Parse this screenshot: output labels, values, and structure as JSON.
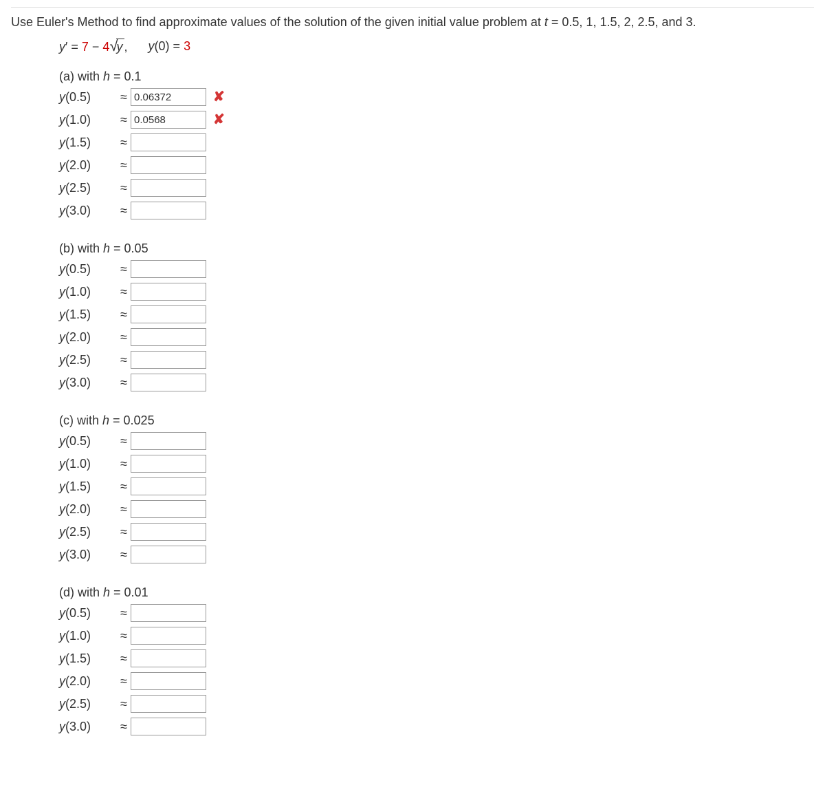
{
  "instruction": {
    "text_before_t": "Use Euler's Method to find approximate values of the solution of the given initial value problem at  ",
    "t_var": "t",
    "text_after_t": " = 0.5, 1, 1.5, 2, 2.5, and 3."
  },
  "equation": {
    "lhs_y": "y",
    "lhs_prime": "′ = ",
    "coef1": "7",
    "minus": " − ",
    "coef2": "4",
    "sqrt_arg": "y",
    "comma": ",",
    "ic_y": "y",
    "ic_rest": "(0) = ",
    "ic_val": "3"
  },
  "approx_symbol": "≈",
  "parts": [
    {
      "key": "a",
      "header_prefix": "(a) with  ",
      "h_var": "h",
      "header_suffix": " = 0.1",
      "rows": [
        {
          "label_y": "y",
          "label_rest": "(0.5)",
          "value": "0.06372",
          "mark": "wrong"
        },
        {
          "label_y": "y",
          "label_rest": "(1.0)",
          "value": "0.0568",
          "mark": "wrong"
        },
        {
          "label_y": "y",
          "label_rest": "(1.5)",
          "value": "",
          "mark": ""
        },
        {
          "label_y": "y",
          "label_rest": "(2.0)",
          "value": "",
          "mark": ""
        },
        {
          "label_y": "y",
          "label_rest": "(2.5)",
          "value": "",
          "mark": ""
        },
        {
          "label_y": "y",
          "label_rest": "(3.0)",
          "value": "",
          "mark": ""
        }
      ]
    },
    {
      "key": "b",
      "header_prefix": "(b) with  ",
      "h_var": "h",
      "header_suffix": " = 0.05",
      "rows": [
        {
          "label_y": "y",
          "label_rest": "(0.5)",
          "value": "",
          "mark": ""
        },
        {
          "label_y": "y",
          "label_rest": "(1.0)",
          "value": "",
          "mark": ""
        },
        {
          "label_y": "y",
          "label_rest": "(1.5)",
          "value": "",
          "mark": ""
        },
        {
          "label_y": "y",
          "label_rest": "(2.0)",
          "value": "",
          "mark": ""
        },
        {
          "label_y": "y",
          "label_rest": "(2.5)",
          "value": "",
          "mark": ""
        },
        {
          "label_y": "y",
          "label_rest": "(3.0)",
          "value": "",
          "mark": ""
        }
      ]
    },
    {
      "key": "c",
      "header_prefix": "(c) with  ",
      "h_var": "h",
      "header_suffix": " = 0.025",
      "rows": [
        {
          "label_y": "y",
          "label_rest": "(0.5)",
          "value": "",
          "mark": ""
        },
        {
          "label_y": "y",
          "label_rest": "(1.0)",
          "value": "",
          "mark": ""
        },
        {
          "label_y": "y",
          "label_rest": "(1.5)",
          "value": "",
          "mark": ""
        },
        {
          "label_y": "y",
          "label_rest": "(2.0)",
          "value": "",
          "mark": ""
        },
        {
          "label_y": "y",
          "label_rest": "(2.5)",
          "value": "",
          "mark": ""
        },
        {
          "label_y": "y",
          "label_rest": "(3.0)",
          "value": "",
          "mark": ""
        }
      ]
    },
    {
      "key": "d",
      "header_prefix": "(d) with  ",
      "h_var": "h",
      "header_suffix": " = 0.01",
      "rows": [
        {
          "label_y": "y",
          "label_rest": "(0.5)",
          "value": "",
          "mark": ""
        },
        {
          "label_y": "y",
          "label_rest": "(1.0)",
          "value": "",
          "mark": ""
        },
        {
          "label_y": "y",
          "label_rest": "(1.5)",
          "value": "",
          "mark": ""
        },
        {
          "label_y": "y",
          "label_rest": "(2.0)",
          "value": "",
          "mark": ""
        },
        {
          "label_y": "y",
          "label_rest": "(2.5)",
          "value": "",
          "mark": ""
        },
        {
          "label_y": "y",
          "label_rest": "(3.0)",
          "value": "",
          "mark": ""
        }
      ]
    }
  ]
}
